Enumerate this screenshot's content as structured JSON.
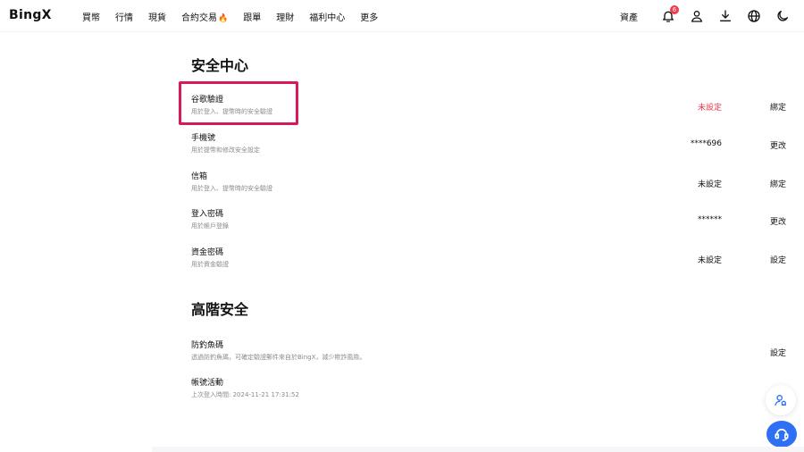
{
  "nav": {
    "logo": "BingX",
    "items": [
      "買幣",
      "行情",
      "現貨",
      "合約交易",
      "跟單",
      "理財",
      "福利中心",
      "更多"
    ],
    "fire_icon": "🔥",
    "assets": "資產",
    "notification_count": "6",
    "icons": [
      "bell-icon",
      "user-icon",
      "download-icon",
      "globe-icon",
      "moon-icon"
    ]
  },
  "security_center": {
    "title": "安全中心",
    "rows": [
      {
        "label": "谷歌驗證",
        "desc": "用於登入、提幣時的安全驗證",
        "status": "未設定",
        "action": "綁定"
      },
      {
        "label": "手機號",
        "desc": "用於提幣和修改安全設定",
        "status": "****696",
        "action": "更改"
      },
      {
        "label": "信箱",
        "desc": "用於登入、提幣時的安全驗證",
        "status": "未設定",
        "action": "綁定"
      },
      {
        "label": "登入密碼",
        "desc": "用於帳戶登錄",
        "status": "******",
        "action": "更改"
      },
      {
        "label": "資金密碼",
        "desc": "用於資金驗證",
        "status": "未設定",
        "action": "設定"
      }
    ]
  },
  "advanced_security": {
    "title": "高階安全",
    "rows": [
      {
        "label": "防釣魚碼",
        "desc": "透過防釣魚碼，可確定驗證郵件來自於BingX，減少欺詐風險。",
        "action": "設定"
      },
      {
        "label": "帳號活動",
        "desc": "上次登入時間: 2024-11-21 17:31:52"
      }
    ]
  },
  "colors": {
    "accent_blue": "#2e6ff4",
    "warning_red": "#e8384f",
    "highlight": "#d9195d"
  }
}
